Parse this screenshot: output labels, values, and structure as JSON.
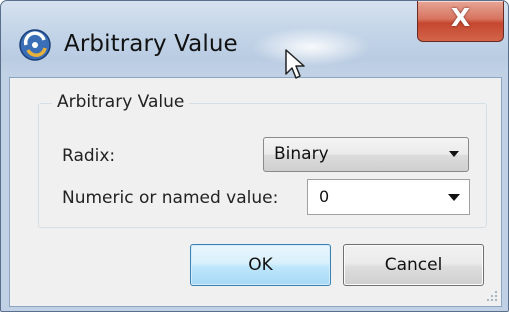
{
  "window": {
    "title": "Arbitrary Value",
    "close_symbol": "X"
  },
  "group": {
    "label": "Arbitrary Value"
  },
  "radix": {
    "label": "Radix:",
    "selected": "Binary"
  },
  "value": {
    "label": "Numeric or named value:",
    "current": "0"
  },
  "buttons": {
    "ok": "OK",
    "cancel": "Cancel"
  },
  "icons": {
    "app": "app-icon",
    "cursor": "mouse-cursor-icon",
    "dropdown": "chevron-down-icon",
    "grip": "resize-grip-icon"
  }
}
